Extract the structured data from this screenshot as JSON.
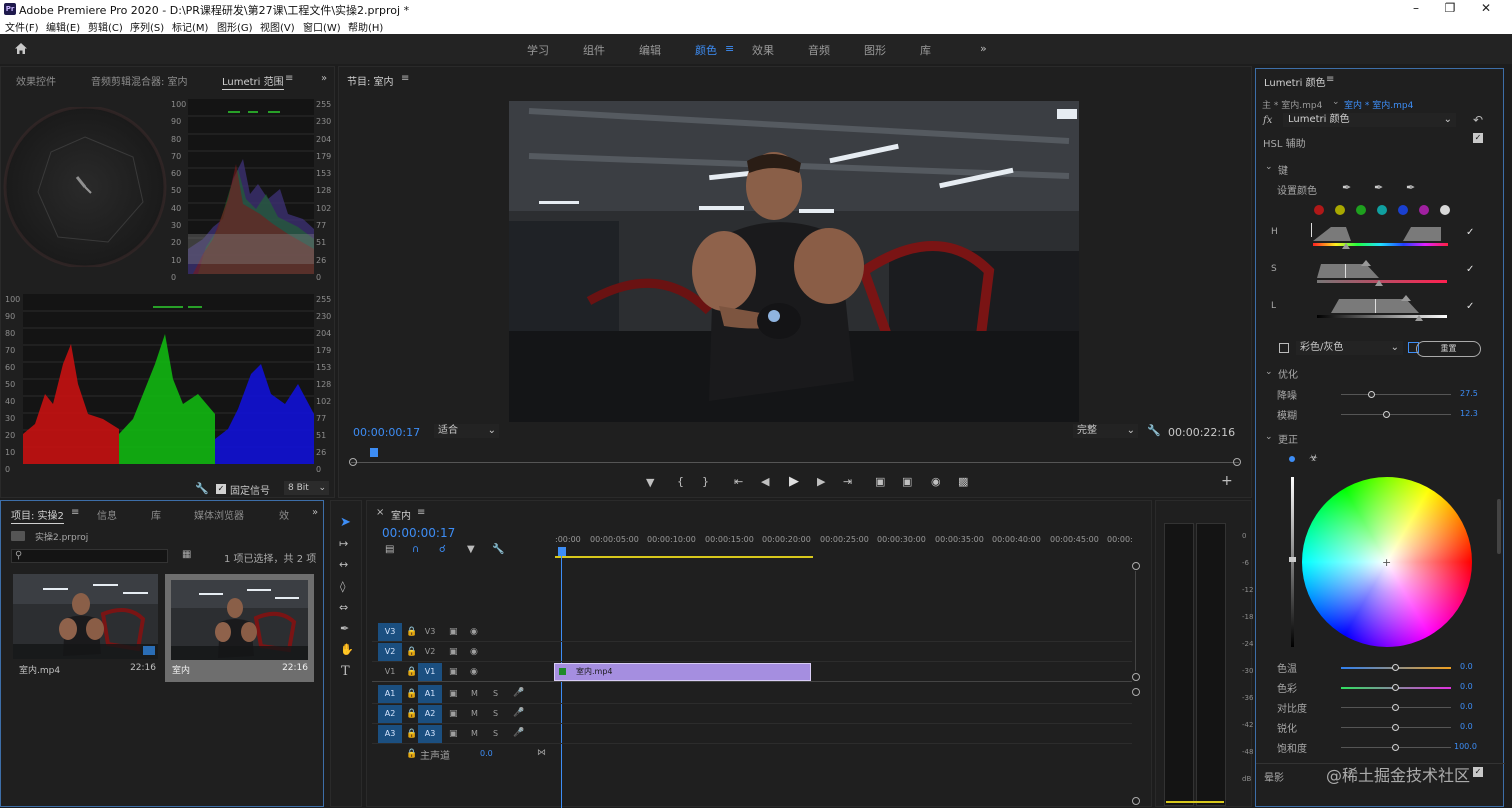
{
  "window": {
    "app_icon": "Pr",
    "title": "Adobe Premiere Pro 2020 - D:\\PR课程研发\\第27课\\工程文件\\实操2.prproj *"
  },
  "menu": [
    "文件(F)",
    "编辑(E)",
    "剪辑(C)",
    "序列(S)",
    "标记(M)",
    "图形(G)",
    "视图(V)",
    "窗口(W)",
    "帮助(H)"
  ],
  "workspaces": [
    "学习",
    "组件",
    "编辑",
    "颜色",
    "效果",
    "音频",
    "图形",
    "库"
  ],
  "workspace_active": "颜色",
  "scopes_panel": {
    "tabs": [
      "效果控件",
      "音频剪辑混合器: 室内",
      "Lumetri 范围"
    ],
    "active_tab": "Lumetri 范围",
    "scale_left": [
      "100",
      "90",
      "80",
      "70",
      "60",
      "50",
      "40",
      "30",
      "20",
      "10",
      "0"
    ],
    "scale_right": [
      "255",
      "230",
      "204",
      "179",
      "153",
      "128",
      "102",
      "77",
      "51",
      "26",
      "0"
    ],
    "clamp_label": "固定信号",
    "bit_depth": "8 Bit"
  },
  "program_monitor": {
    "title": "节目: 室内",
    "timecode_current": "00:00:00:17",
    "fit": "适合",
    "quality": "完整",
    "timecode_duration": "00:00:22:16"
  },
  "project_panel": {
    "tabs": [
      "项目: 实操2",
      "信息",
      "库",
      "媒体浏览器",
      "效"
    ],
    "active_tab": "项目: 实操2",
    "project_file": "实操2.prproj",
    "selection_status": "1 项已选择，共 2 项",
    "items": [
      {
        "name": "室内.mp4",
        "duration": "22:16"
      },
      {
        "name": "室内",
        "duration": "22:16"
      }
    ]
  },
  "timeline": {
    "title": "室内",
    "timecode": "00:00:00:17",
    "ruler": [
      ":00:00",
      "00:00:05:00",
      "00:00:10:00",
      "00:00:15:00",
      "00:00:20:00",
      "00:00:25:00",
      "00:00:30:00",
      "00:00:35:00",
      "00:00:40:00",
      "00:00:45:00",
      "00:00:"
    ],
    "video_tracks": [
      "V3",
      "V2",
      "V1"
    ],
    "audio_tracks": [
      "A1",
      "A2",
      "A3"
    ],
    "mute_label": "M",
    "solo_label": "S",
    "clip_name": "室内.mp4",
    "master_label": "主声道",
    "master_value": "0.0",
    "meter_scale": [
      "0",
      "-6",
      "-12",
      "-18",
      "-24",
      "-30",
      "-36",
      "-42",
      "-48",
      "dB"
    ]
  },
  "lumetri": {
    "title": "Lumetri 颜色",
    "source": "主 * 室内.mp4",
    "sequence_clip": "室内 * 室内.mp4",
    "effect_label": "fx",
    "effect": "Lumetri 颜色",
    "section_hsl": "HSL 辅助",
    "section_key": "键",
    "set_color": "设置颜色",
    "swatches": [
      "#b01818",
      "#a8a800",
      "#1ea01e",
      "#10a0a0",
      "#1a40d0",
      "#a020a0",
      "#d8d8d8"
    ],
    "hsl_labels": [
      "H",
      "S",
      "L"
    ],
    "mode_option": "彩色/灰色",
    "reset_label": "重置",
    "section_refine": "优化",
    "refine": [
      {
        "label": "降噪",
        "value": "27.5",
        "pos": 0.28
      },
      {
        "label": "模糊",
        "value": "12.3",
        "pos": 0.42
      }
    ],
    "section_correct": "更正",
    "corrections": [
      {
        "label": "色温",
        "value": "0.0",
        "pos": 0.5
      },
      {
        "label": "色彩",
        "value": "0.0",
        "pos": 0.5
      },
      {
        "label": "对比度",
        "value": "0.0",
        "pos": 0.5
      },
      {
        "label": "锐化",
        "value": "0.0",
        "pos": 0.5
      },
      {
        "label": "饱和度",
        "value": "100.0",
        "pos": 0.5
      }
    ],
    "section_vignette": "晕影"
  },
  "watermark": "@稀土掘金技术社区",
  "colors": {
    "accent": "#3d8df5",
    "clip": "#a58ee0",
    "track_on": "#1b4f80"
  }
}
